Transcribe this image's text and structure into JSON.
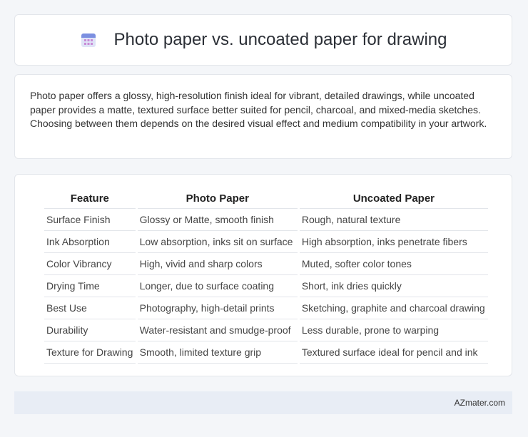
{
  "header": {
    "title": "Photo paper vs. uncoated paper for drawing",
    "icon": "calendar-icon"
  },
  "description": "Photo paper offers a glossy, high-resolution finish ideal for vibrant, detailed drawings, while uncoated paper provides a matte, textured surface better suited for pencil, charcoal, and mixed-media sketches. Choosing between them depends on the desired visual effect and medium compatibility in your artwork.",
  "table": {
    "headers": [
      "Feature",
      "Photo Paper",
      "Uncoated Paper"
    ],
    "rows": [
      [
        "Surface Finish",
        "Glossy or Matte, smooth finish",
        "Rough, natural texture"
      ],
      [
        "Ink Absorption",
        "Low absorption, inks sit on surface",
        "High absorption, inks penetrate fibers"
      ],
      [
        "Color Vibrancy",
        "High, vivid and sharp colors",
        "Muted, softer color tones"
      ],
      [
        "Drying Time",
        "Longer, due to surface coating",
        "Short, ink dries quickly"
      ],
      [
        "Best Use",
        "Photography, high-detail prints",
        "Sketching, graphite and charcoal drawing"
      ],
      [
        "Durability",
        "Water-resistant and smudge-proof",
        "Less durable, prone to warping"
      ],
      [
        "Texture for Drawing",
        "Smooth, limited texture grip",
        "Textured surface ideal for pencil and ink"
      ]
    ]
  },
  "footer": {
    "source": "AZmater.com"
  }
}
